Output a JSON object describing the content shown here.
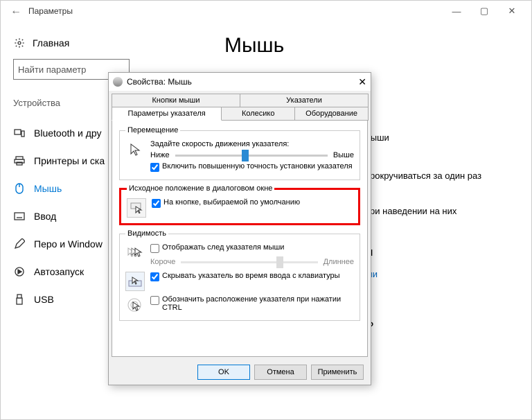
{
  "settings": {
    "app_title": "Параметры",
    "home": "Главная",
    "search_placeholder": "Найти параметр",
    "group": "Устройства",
    "items": [
      {
        "label": "Bluetooth и дру"
      },
      {
        "label": "Принтеры и ска"
      },
      {
        "label": "Мышь"
      },
      {
        "label": "Ввод"
      },
      {
        "label": "Перо и Window"
      },
      {
        "label": "Автозапуск"
      },
      {
        "label": "USB"
      }
    ],
    "page_heading": "Мышь",
    "right_fragments": {
      "a": "ка мыши",
      "b": "но прокручиваться за один раз",
      "c": "на при наведении на них",
      "d": "тры",
      "e": "мыши",
      "f": "сы?"
    }
  },
  "dialog": {
    "title": "Свойства: Мышь",
    "tabs_row1": [
      "Кнопки мыши",
      "Указатели"
    ],
    "tabs_row2": [
      "Параметры указателя",
      "Колесико",
      "Оборудование"
    ],
    "grp_move": {
      "legend": "Перемещение",
      "label": "Задайте скорость движения указателя:",
      "lo": "Ниже",
      "hi": "Выше",
      "enhance": "Включить повышенную точность установки указателя"
    },
    "grp_default": {
      "legend": "Исходное положение в диалоговом окне",
      "cb": "На кнопке, выбираемой по умолчанию"
    },
    "grp_vis": {
      "legend": "Видимость",
      "trail": "Отображать след указателя мыши",
      "short": "Короче",
      "long": "Длиннее",
      "hide": "Скрывать указатель во время ввода с клавиатуры",
      "ctrl": "Обозначить расположение указателя при нажатии CTRL"
    },
    "buttons": {
      "ok": "OK",
      "cancel": "Отмена",
      "apply": "Применить"
    }
  }
}
